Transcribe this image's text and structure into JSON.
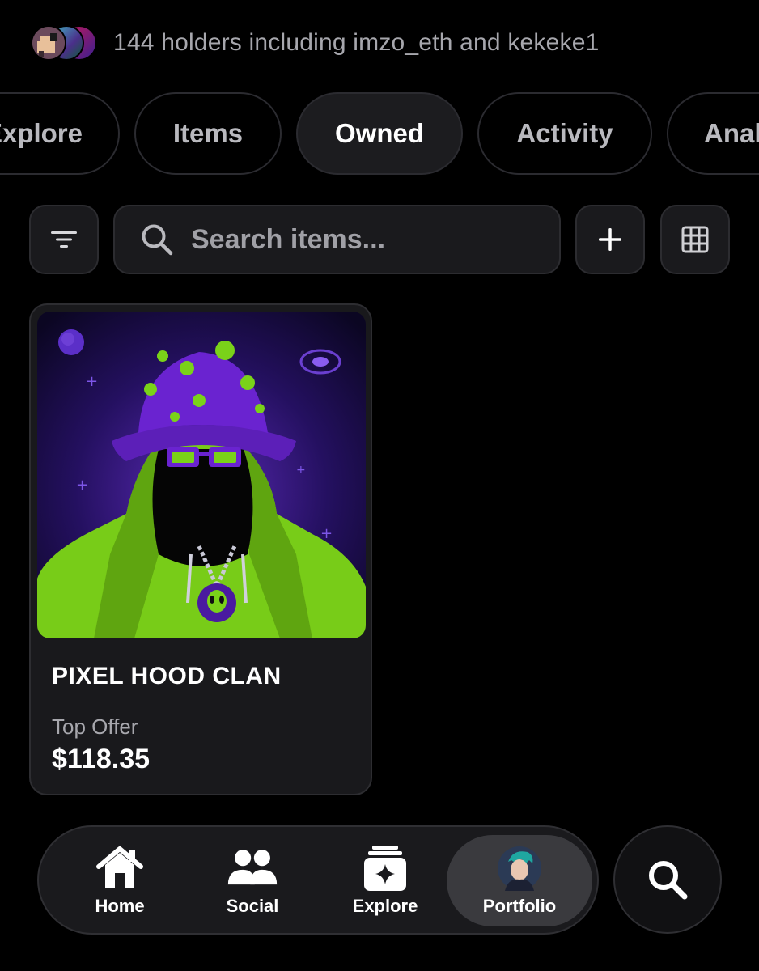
{
  "holders": {
    "text": "144 holders including imzo_eth and kekeke1"
  },
  "tabs": [
    {
      "label": "Explore",
      "active": false
    },
    {
      "label": "Items",
      "active": false
    },
    {
      "label": "Owned",
      "active": true
    },
    {
      "label": "Activity",
      "active": false
    },
    {
      "label": "Analytics",
      "active": false
    }
  ],
  "toolbar": {
    "search_placeholder": "Search items...",
    "filter_icon": "filter-icon",
    "add_icon": "plus-icon",
    "grid_icon": "grid-icon"
  },
  "items": [
    {
      "name": "PIXEL HOOD CLAN",
      "offer_label": "Top Offer",
      "offer_value": "$118.35"
    }
  ],
  "nav": {
    "items": [
      {
        "label": "Home",
        "icon": "home-icon"
      },
      {
        "label": "Social",
        "icon": "people-icon"
      },
      {
        "label": "Explore",
        "icon": "sparkle-cards-icon"
      },
      {
        "label": "Portfolio",
        "icon": "avatar",
        "active": true
      }
    ],
    "search_icon": "search-icon"
  },
  "colors": {
    "background": "#000000",
    "surface": "#1a1a1d",
    "muted_text": "#a7a7ad",
    "nft_purple": "#6a1fc9",
    "nft_green": "#7ad219"
  }
}
